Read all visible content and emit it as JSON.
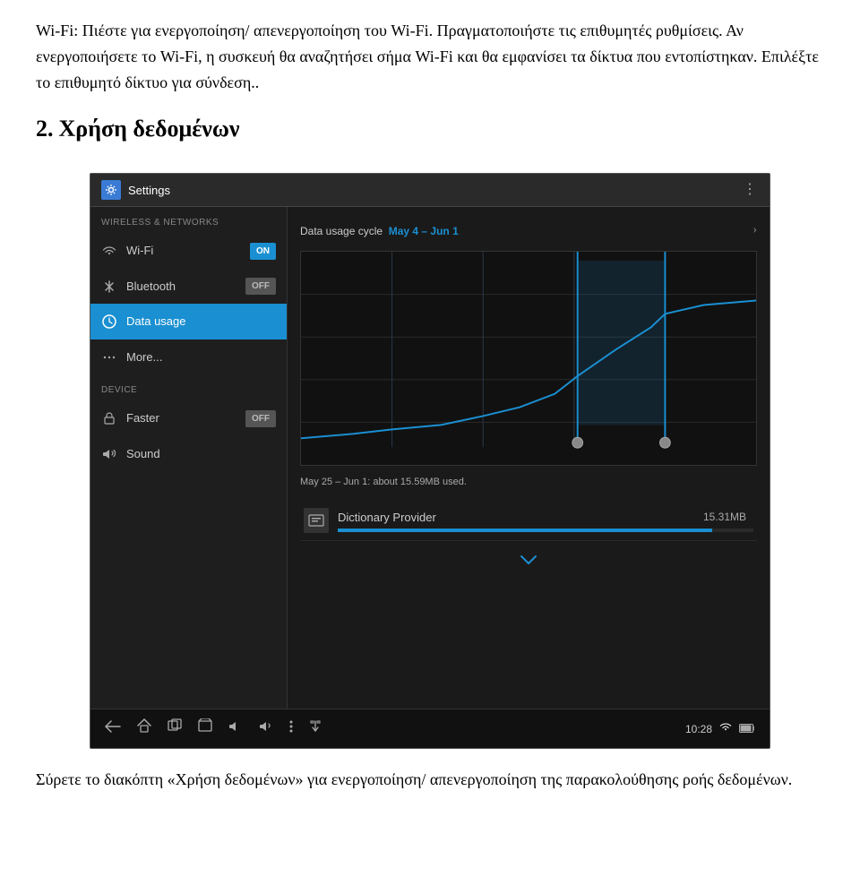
{
  "intro": {
    "text1": "Wi-Fi: Πιέστε για ενεργοποίηση/ απενεργοποίηση του Wi-Fi. Πραγματοποιήστε τις επιθυμητές ρυθμίσεις. Αν ενεργοποιήσετε το Wi-Fi, η συσκευή θα αναζητήσει σήμα Wi-Fi και θα εμφανίσει τα δίκτυα που εντοπίστηκαν. Επιλέξτε το επιθυμητό δίκτυο για σύνδεση.."
  },
  "section": {
    "number": "2.",
    "title": "Χρήση δεδομένων"
  },
  "titlebar": {
    "icon_label": "settings-icon",
    "title": "Settings",
    "menu_dots": "⋮"
  },
  "sidebar": {
    "section1_label": "WIRELESS & NETWORKS",
    "items": [
      {
        "id": "wifi",
        "label": "Wi-Fi",
        "toggle": "ON",
        "toggle_state": "on",
        "icon": "wifi"
      },
      {
        "id": "bluetooth",
        "label": "Bluetooth",
        "toggle": "OFF",
        "toggle_state": "off",
        "icon": "bluetooth"
      },
      {
        "id": "data_usage",
        "label": "Data usage",
        "toggle": null,
        "active": true,
        "icon": "data"
      },
      {
        "id": "more",
        "label": "More...",
        "toggle": null,
        "icon": "more"
      }
    ],
    "section2_label": "DEVICE",
    "items2": [
      {
        "id": "faster",
        "label": "Faster",
        "toggle": "OFF",
        "toggle_state": "off",
        "icon": "lock"
      },
      {
        "id": "sound",
        "label": "Sound",
        "toggle": null,
        "icon": "sound"
      }
    ]
  },
  "content": {
    "cycle_label": "Data usage cycle",
    "cycle_value": "May 4 – Jun 1",
    "chart": {
      "lines": [
        0.2,
        0.45,
        0.6,
        0.8
      ],
      "bar_x": 0.78,
      "handle1_x": 0.55,
      "handle2_x": 0.78
    },
    "range_text": "May 25 – Jun 1: about 15.59MB used.",
    "apps": [
      {
        "name": "Dictionary Provider",
        "size": "15.31MB",
        "bar_pct": 90
      }
    ]
  },
  "navbar": {
    "time": "10:28",
    "icons": [
      "back",
      "home",
      "recents",
      "screenshot",
      "volume-down",
      "volume-up",
      "menu",
      "usb",
      "camera",
      "gallery",
      "wifi",
      "battery"
    ]
  },
  "footer": {
    "text": "Σύρετε το διακόπτη «Χρήση δεδομένων» για ενεργοποίηση/ απενεργοποίηση της παρακολούθησης ροής δεδομένων."
  }
}
